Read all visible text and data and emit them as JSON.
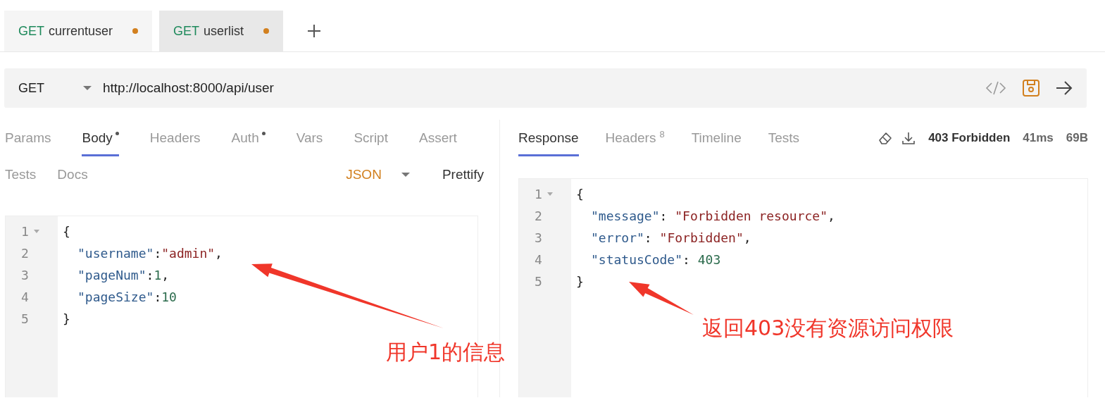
{
  "request_tabs": [
    {
      "method": "GET",
      "name": "currentuser",
      "modified": true,
      "selected": false
    },
    {
      "method": "GET",
      "name": "userlist",
      "modified": true,
      "selected": true
    }
  ],
  "url_bar": {
    "method": "GET",
    "url": "http://localhost:8000/api/user"
  },
  "request_panel": {
    "tabs": [
      {
        "label": "Params",
        "dot": false,
        "selected": false
      },
      {
        "label": "Body",
        "dot": true,
        "selected": true
      },
      {
        "label": "Headers",
        "dot": false,
        "selected": false
      },
      {
        "label": "Auth",
        "dot": true,
        "selected": false
      },
      {
        "label": "Vars",
        "dot": false,
        "selected": false
      },
      {
        "label": "Script",
        "dot": false,
        "selected": false
      },
      {
        "label": "Assert",
        "dot": false,
        "selected": false
      },
      {
        "label": "Tests",
        "dot": false,
        "selected": false
      },
      {
        "label": "Docs",
        "dot": false,
        "selected": false
      }
    ],
    "body_mode": "JSON",
    "prettify": "Prettify",
    "editor": [
      {
        "number": "1",
        "foldable": true,
        "nested": false,
        "tokens": [
          {
            "kind": "punct",
            "text": "{"
          }
        ]
      },
      {
        "number": "2",
        "foldable": false,
        "nested": true,
        "tokens": [
          {
            "kind": "key",
            "text": "\"username\""
          },
          {
            "kind": "punct",
            "text": ":"
          },
          {
            "kind": "string",
            "text": "\"admin\""
          },
          {
            "kind": "punct",
            "text": ","
          }
        ]
      },
      {
        "number": "3",
        "foldable": false,
        "nested": true,
        "tokens": [
          {
            "kind": "key",
            "text": "\"pageNum\""
          },
          {
            "kind": "punct",
            "text": ":"
          },
          {
            "kind": "number",
            "text": "1"
          },
          {
            "kind": "punct",
            "text": ","
          }
        ]
      },
      {
        "number": "4",
        "foldable": false,
        "nested": true,
        "tokens": [
          {
            "kind": "key",
            "text": "\"pageSize\""
          },
          {
            "kind": "punct",
            "text": ":"
          },
          {
            "kind": "number",
            "text": "10"
          }
        ]
      },
      {
        "number": "5",
        "foldable": false,
        "nested": false,
        "tokens": [
          {
            "kind": "punct",
            "text": "}"
          }
        ]
      }
    ]
  },
  "response_panel": {
    "tabs": [
      {
        "label": "Response",
        "selected": true
      },
      {
        "label": "Headers",
        "count": "8",
        "selected": false
      },
      {
        "label": "Timeline",
        "selected": false
      },
      {
        "label": "Tests",
        "selected": false
      }
    ],
    "status": "403 Forbidden",
    "time": "41ms",
    "size": "69B",
    "editor": [
      {
        "number": "1",
        "foldable": true,
        "nested": false,
        "tokens": [
          {
            "kind": "punct",
            "text": "{"
          }
        ]
      },
      {
        "number": "2",
        "foldable": false,
        "nested": true,
        "tokens": [
          {
            "kind": "key",
            "text": "\"message\""
          },
          {
            "kind": "punct",
            "text": ": "
          },
          {
            "kind": "string",
            "text": "\"Forbidden resource\""
          },
          {
            "kind": "punct",
            "text": ","
          }
        ]
      },
      {
        "number": "3",
        "foldable": false,
        "nested": true,
        "tokens": [
          {
            "kind": "key",
            "text": "\"error\""
          },
          {
            "kind": "punct",
            "text": ": "
          },
          {
            "kind": "string",
            "text": "\"Forbidden\""
          },
          {
            "kind": "punct",
            "text": ","
          }
        ]
      },
      {
        "number": "4",
        "foldable": false,
        "nested": true,
        "tokens": [
          {
            "kind": "key",
            "text": "\"statusCode\""
          },
          {
            "kind": "punct",
            "text": ": "
          },
          {
            "kind": "number",
            "text": "403"
          }
        ]
      },
      {
        "number": "5",
        "foldable": false,
        "nested": false,
        "tokens": [
          {
            "kind": "punct",
            "text": "}"
          }
        ]
      }
    ]
  },
  "annotations": [
    {
      "text": "用户1的信息"
    },
    {
      "text": "返回403没有资源访问权限"
    }
  ]
}
